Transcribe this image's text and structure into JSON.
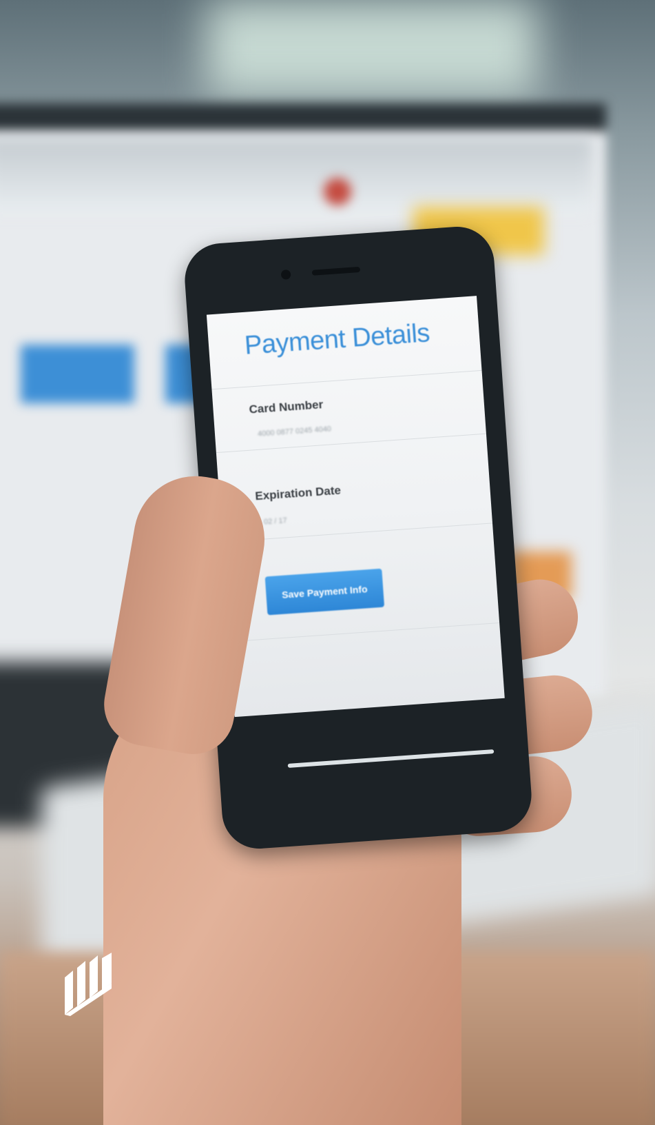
{
  "scene": {
    "description_free": true
  },
  "phone_screen": {
    "title": "Payment Details",
    "card_number_label": "Card Number",
    "card_number_value": "4000 0877 0245 4040",
    "expiration_label": "Expiration Date",
    "expiration_value": "02 / 17",
    "save_button_label": "Save Payment Info"
  },
  "colors": {
    "accent": "#3a8fd8",
    "button": "#2d86d6"
  },
  "icons": {
    "logo": "brand-logo-icon"
  }
}
